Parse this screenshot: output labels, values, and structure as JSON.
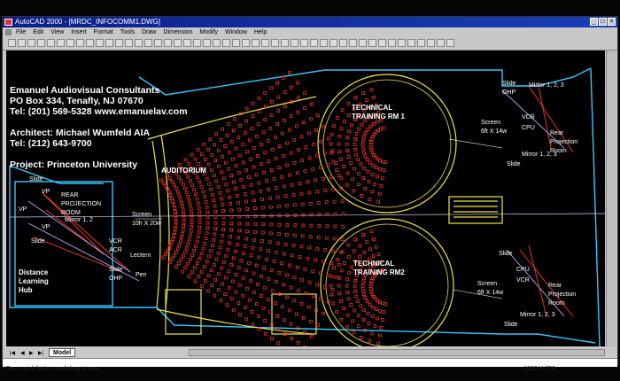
{
  "window": {
    "title": "AutoCAD 2000 - [MRDC_INFOCOMM1.DWG]",
    "controls": [
      "_",
      "□",
      "×"
    ]
  },
  "menu": [
    "File",
    "Edit",
    "View",
    "Insert",
    "Format",
    "Tools",
    "Draw",
    "Dimension",
    "Modify",
    "Window",
    "Help"
  ],
  "drawing": {
    "company": [
      "Emanuel Audiovisual Consultants",
      "PO Box 334, Tenafly, NJ 07670",
      "Tel: (201) 569-5328 www.emanuelav.com"
    ],
    "architect": [
      "Architect: Michael Wumfeld AIA",
      "Tel: (212) 643-9700"
    ],
    "project": "Project: Princeton University",
    "labels": {
      "auditorium": "AUDITORIUM",
      "tech_rm1": [
        "TECHNICAL",
        "TRAINING RM 1"
      ],
      "tech_rm2": [
        "TECHNICAL",
        "TRAINING RM2"
      ],
      "slide": "Slide",
      "vp": "VP",
      "rear_projection": [
        "REAR",
        "PROJECTION",
        "ROOM"
      ],
      "screen_aud": [
        "Screen",
        "10h X 20w"
      ],
      "vcr": "VCR",
      "acr": "ACR",
      "lectern": "Lectern",
      "slide_ohp": [
        "Slide",
        "OHP"
      ],
      "pen": "Pen",
      "mirror_12": "Mirror 1, 2",
      "mirror_123": "Mirror 1, 2, 3",
      "distance_hub": [
        "Distance",
        "Learning",
        "Hub"
      ],
      "ohp": "OHP",
      "cpu": "CPU",
      "rear_proj_room": [
        "Rear",
        "Projection",
        "Room"
      ],
      "screen_rm": [
        "Screen",
        "6ft X 14w"
      ],
      "screen_rm2": [
        "Screen",
        "6ft X 14w"
      ],
      "mirror_rm": "Mirror 1, 2, 3"
    }
  },
  "tabs": {
    "active": "Model"
  },
  "command_prompt": "Press pick button and drag to pan.",
  "coordinates": "1280 X 720",
  "colors": {
    "titlebar": "#0a1f8a",
    "canvas": "#000000",
    "seats": "#ff3b2f",
    "walls": "#f0e44a",
    "cyan": "#37c6ff"
  }
}
